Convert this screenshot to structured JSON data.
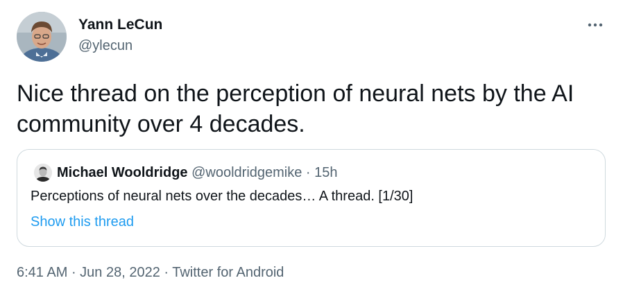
{
  "author": {
    "name": "Yann LeCun",
    "handle": "@ylecun"
  },
  "tweet": {
    "text": "Nice thread on the perception of neural nets by the AI community over 4 decades."
  },
  "quoted_tweet": {
    "name": "Michael Wooldridge",
    "handle": "@wooldridgemike",
    "separator": " · ",
    "time": "15h",
    "text": "Perceptions of neural nets over the decades… A thread. [1/30]",
    "show_thread_label": "Show this thread"
  },
  "footer": {
    "time": "6:41 AM",
    "sep1": " · ",
    "date": "Jun 28, 2022",
    "sep2": " · ",
    "source": "Twitter for Android"
  },
  "icons": {
    "more": "more-horizontal-icon"
  },
  "colors": {
    "text": "#0f1419",
    "secondary": "#536471",
    "link": "#1d9bf0",
    "border": "#cfd9de"
  }
}
